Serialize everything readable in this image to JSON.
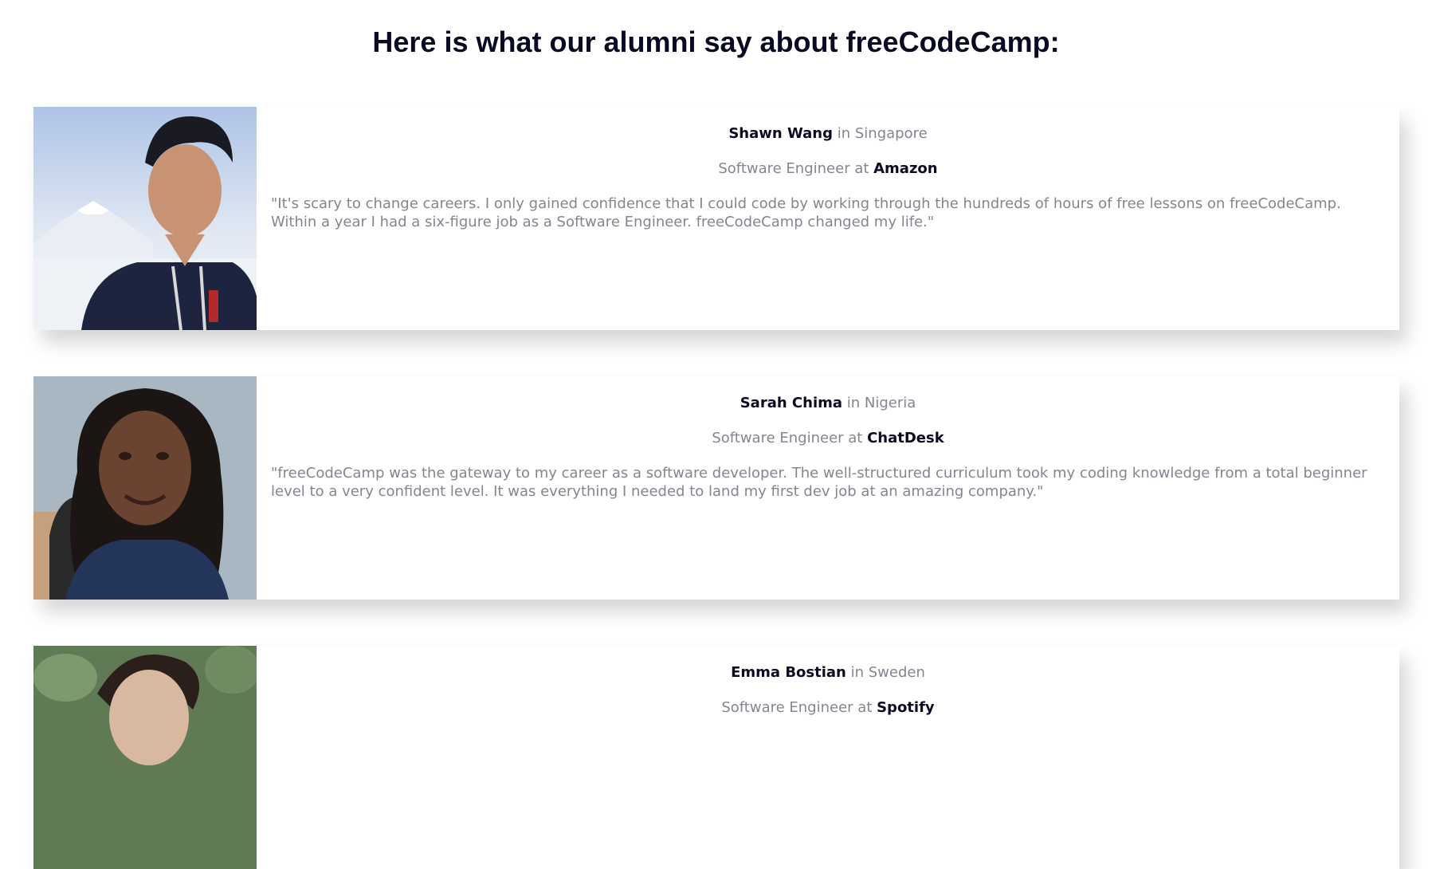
{
  "heading": "Here is what our alumni say about freeCodeCamp:",
  "testimonials": [
    {
      "name": "Shawn Wang",
      "location_prefix": " in ",
      "location": "Singapore",
      "role_prefix": "Software Engineer at ",
      "company": "Amazon",
      "quote": "\"It's scary to change careers. I only gained confidence that I could code by working through the hundreds of hours of free lessons on freeCodeCamp. Within a year I had a six-figure job as a Software Engineer. freeCodeCamp changed my life.\""
    },
    {
      "name": "Sarah Chima",
      "location_prefix": " in ",
      "location": "Nigeria",
      "role_prefix": "Software Engineer at ",
      "company": "ChatDesk",
      "quote": "\"freeCodeCamp was the gateway to my career as a software developer. The well-structured curriculum took my coding knowledge from a total beginner level to a very confident level. It was everything I needed to land my first dev job at an amazing company.\""
    },
    {
      "name": "Emma Bostian",
      "location_prefix": " in ",
      "location": "Sweden",
      "role_prefix": "Software Engineer at ",
      "company": "Spotify",
      "quote": ""
    }
  ],
  "colors": {
    "heading": "#0a0a23",
    "muted_text": "#858591",
    "card_background": "#ffffff"
  }
}
